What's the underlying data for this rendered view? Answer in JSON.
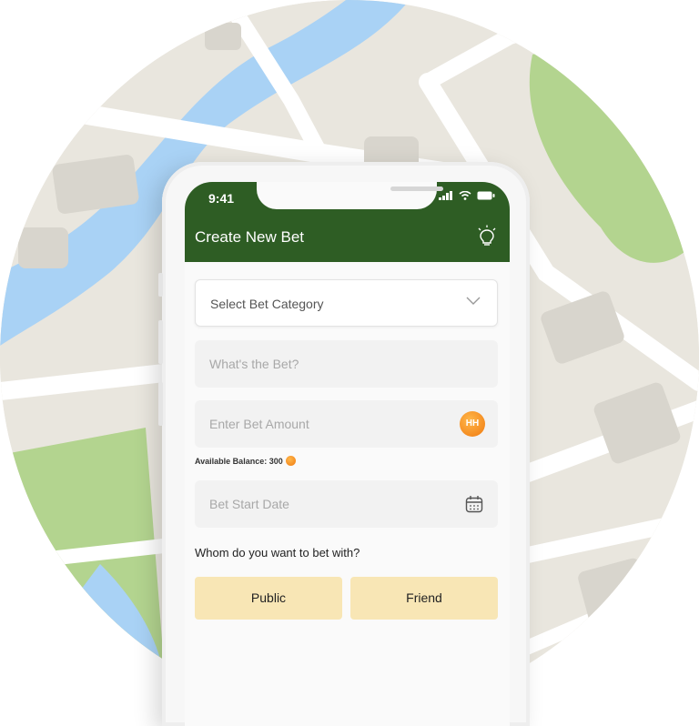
{
  "status_bar": {
    "time": "9:41"
  },
  "header": {
    "title": "Create New Bet",
    "icon": "lightbulb-icon"
  },
  "form": {
    "category": {
      "value": "Select Bet Category"
    },
    "bet_description": {
      "placeholder": "What's the Bet?"
    },
    "bet_amount": {
      "placeholder": "Enter Bet Amount",
      "coin_label": "HH"
    },
    "balance": {
      "text": "Available Balance: 300"
    },
    "start_date": {
      "placeholder": "Bet Start Date"
    },
    "question": "Whom do you want to bet with?",
    "options": [
      {
        "label": "Public"
      },
      {
        "label": "Friend"
      }
    ]
  },
  "colors": {
    "header_bg": "#2e5d24",
    "option_bg": "#f8e6b5",
    "coin": "#f07a10",
    "map_water": "#a9d2f5",
    "map_park": "#b3d48f"
  }
}
